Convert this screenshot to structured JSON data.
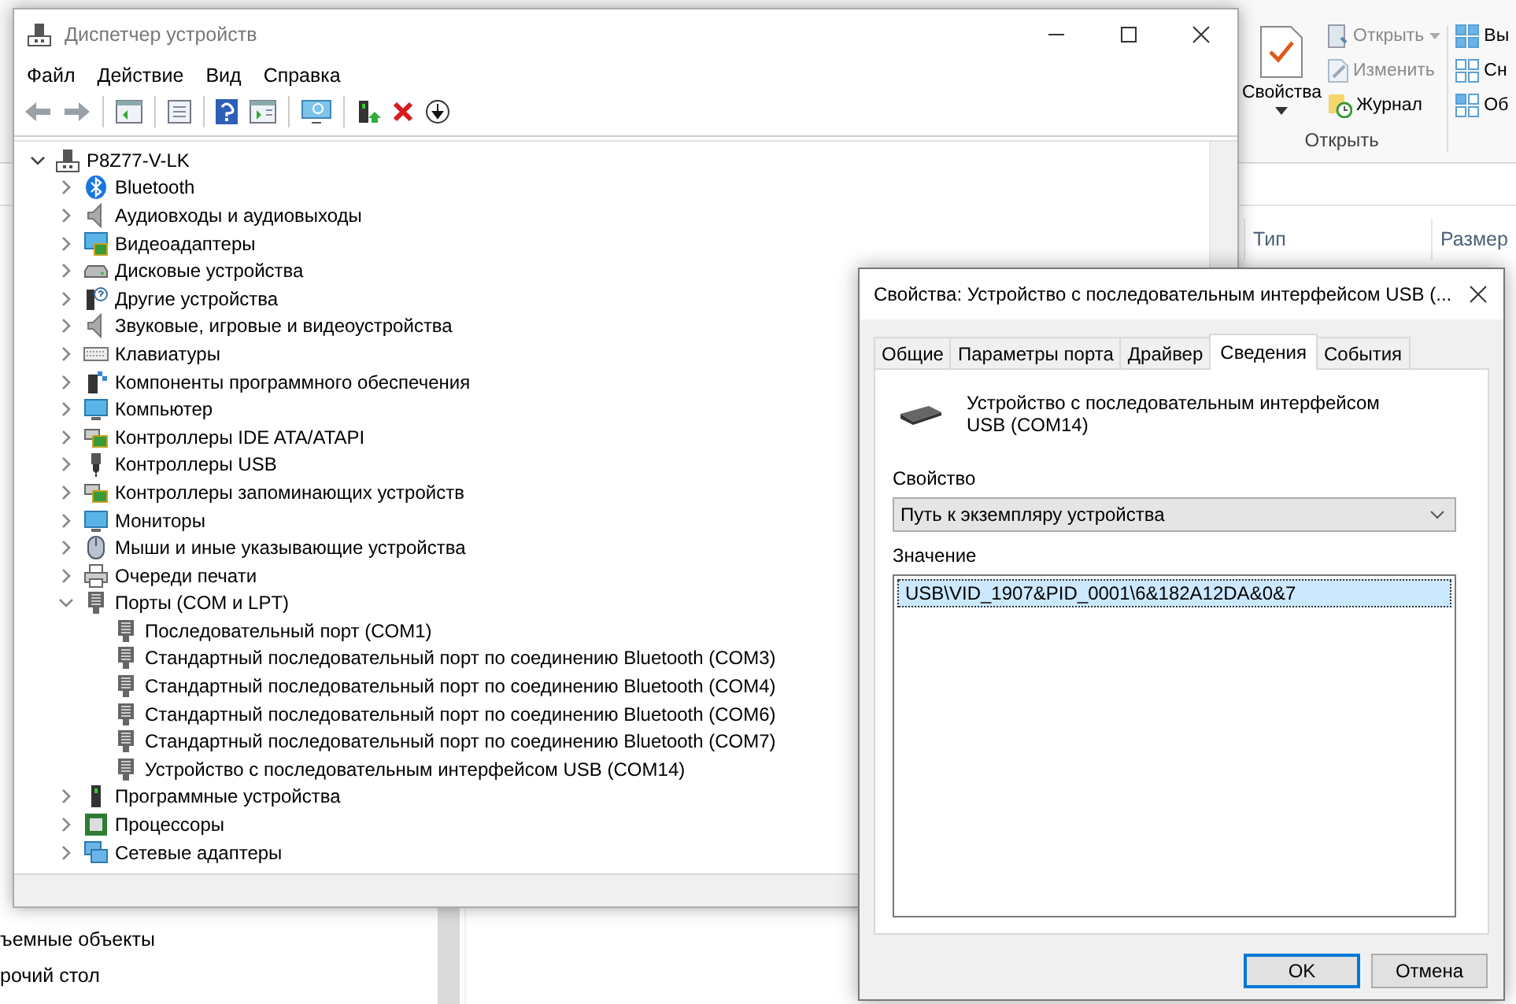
{
  "explorer": {
    "ribbon": {
      "properties_button": "Свойства",
      "open_button": "Открыть",
      "edit_button": "Изменить",
      "history_button": "Журнал",
      "group_label": "Открыть",
      "select_items": [
        "Вы",
        "Сн",
        "Об"
      ]
    },
    "columns": [
      "Тип",
      "Размер"
    ],
    "nav_items": [
      "ъемные объекты",
      "рочий стол"
    ]
  },
  "device_manager": {
    "title": "Диспетчер устройств",
    "menu": [
      "Файл",
      "Действие",
      "Вид",
      "Справка"
    ],
    "tree": {
      "label": "P8Z77-V-LK",
      "expanded": true,
      "children": [
        {
          "label": "Bluetooth",
          "expanded": false
        },
        {
          "label": "Аудиовходы и аудиовыходы",
          "expanded": false
        },
        {
          "label": "Видеоадаптеры",
          "expanded": false
        },
        {
          "label": "Дисковые устройства",
          "expanded": false
        },
        {
          "label": "Другие устройства",
          "expanded": false
        },
        {
          "label": "Звуковые, игровые и видеоустройства",
          "expanded": false
        },
        {
          "label": "Клавиатуры",
          "expanded": false
        },
        {
          "label": "Компоненты программного обеспечения",
          "expanded": false
        },
        {
          "label": "Компьютер",
          "expanded": false
        },
        {
          "label": "Контроллеры IDE ATA/ATAPI",
          "expanded": false
        },
        {
          "label": "Контроллеры USB",
          "expanded": false
        },
        {
          "label": "Контроллеры запоминающих устройств",
          "expanded": false
        },
        {
          "label": "Мониторы",
          "expanded": false
        },
        {
          "label": "Мыши и иные указывающие устройства",
          "expanded": false
        },
        {
          "label": "Очереди печати",
          "expanded": false
        },
        {
          "label": "Порты (COM и LPT)",
          "expanded": true,
          "children": [
            {
              "label": "Последовательный порт (COM1)"
            },
            {
              "label": "Стандартный последовательный порт по соединению Bluetooth (COM3)"
            },
            {
              "label": "Стандартный последовательный порт по соединению Bluetooth (COM4)"
            },
            {
              "label": "Стандартный последовательный порт по соединению Bluetooth (COM6)"
            },
            {
              "label": "Стандартный последовательный порт по соединению Bluetooth (COM7)"
            },
            {
              "label": "Устройство с последовательным интерфейсом USB (COM14)"
            }
          ]
        },
        {
          "label": "Программные устройства",
          "expanded": false
        },
        {
          "label": "Процессоры",
          "expanded": false
        },
        {
          "label": "Сетевые адаптеры",
          "expanded": false
        }
      ]
    }
  },
  "dialog": {
    "title": "Свойства: Устройство с последовательным интерфейсом USB (...",
    "tabs": [
      {
        "label": "Общие",
        "selected": false
      },
      {
        "label": "Параметры порта",
        "selected": false
      },
      {
        "label": "Драйвер",
        "selected": false
      },
      {
        "label": "Сведения",
        "selected": true
      },
      {
        "label": "События",
        "selected": false
      }
    ],
    "device_name": "Устройство с последовательным интерфейсом USB (COM14)",
    "property_label": "Свойство",
    "property_value": "Путь к экземпляру устройства",
    "value_label": "Значение",
    "values": [
      {
        "text": "USB\\VID_1907&PID_0001\\6&182A12DA&0&7",
        "selected": true
      }
    ],
    "buttons": [
      {
        "label": "OK",
        "default": true
      },
      {
        "label": "Отмена",
        "default": false
      }
    ]
  }
}
